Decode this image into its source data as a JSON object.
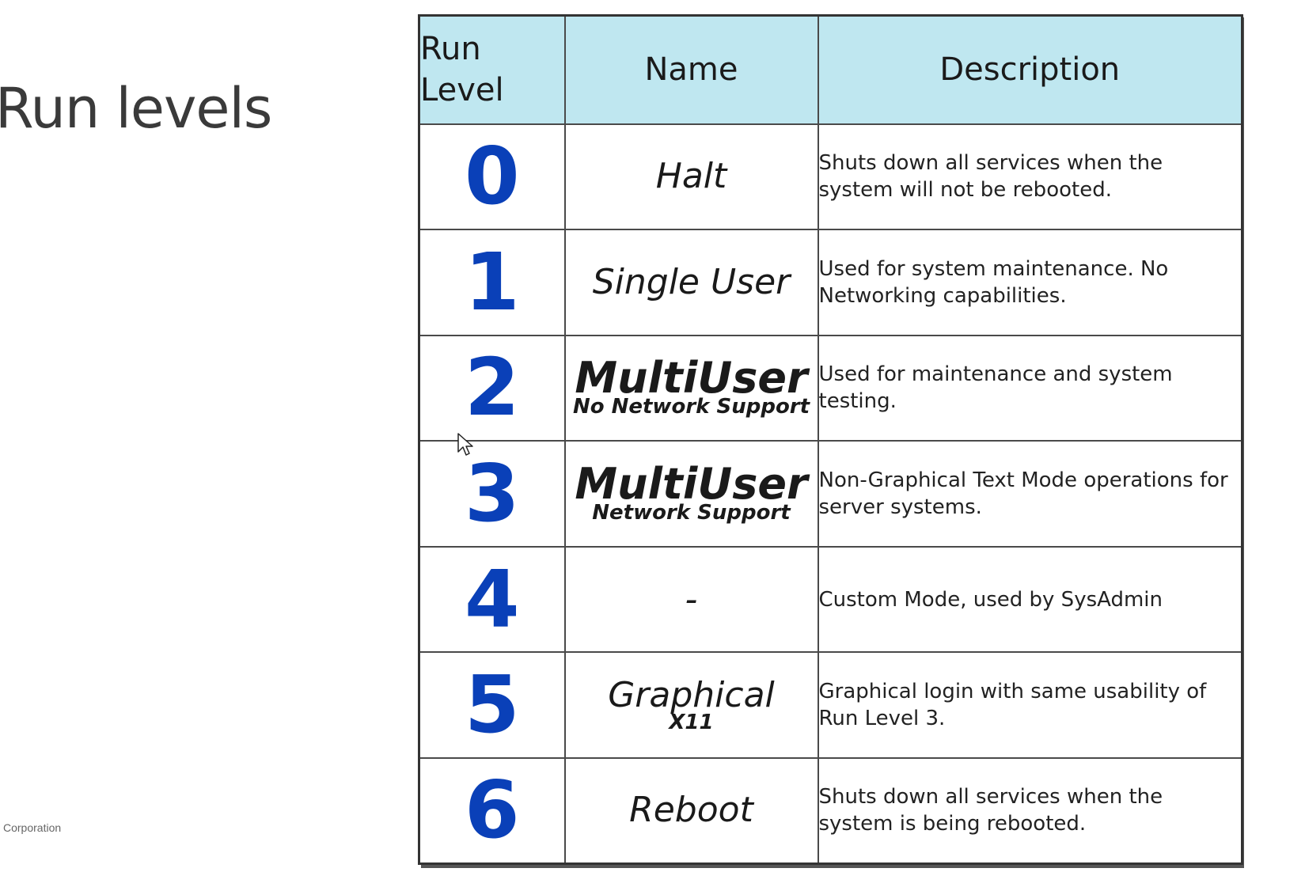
{
  "slide": {
    "title": "Run levels",
    "footer": "Corporation"
  },
  "table": {
    "headers": {
      "level_line1": "Run",
      "level_line2": "Level",
      "name": "Name",
      "description": "Description"
    },
    "rows": [
      {
        "level": "0",
        "name": "Halt",
        "name_sub": "",
        "description": "Shuts down all services when the system will not be rebooted."
      },
      {
        "level": "1",
        "name": "Single User",
        "name_sub": "",
        "description": "Used for system maintenance. No Networking capabilities."
      },
      {
        "level": "2",
        "name": "MultiUser",
        "name_sub": "No Network Support",
        "description": "Used for maintenance and system testing."
      },
      {
        "level": "3",
        "name": "MultiUser",
        "name_sub": "Network Support",
        "description": "Non-Graphical Text Mode operations for server systems."
      },
      {
        "level": "4",
        "name": "-",
        "name_sub": "",
        "description": "Custom Mode, used by SysAdmin"
      },
      {
        "level": "5",
        "name": "Graphical",
        "name_sub": "X11",
        "description": "Graphical login with same usability of Run Level 3."
      },
      {
        "level": "6",
        "name": "Reboot",
        "name_sub": "",
        "description": "Shuts down all services when the system is being rebooted."
      }
    ]
  },
  "colors": {
    "header_bg": "#bfe7f0",
    "level_number": "#0a40b8",
    "border": "#4a4a4a"
  }
}
